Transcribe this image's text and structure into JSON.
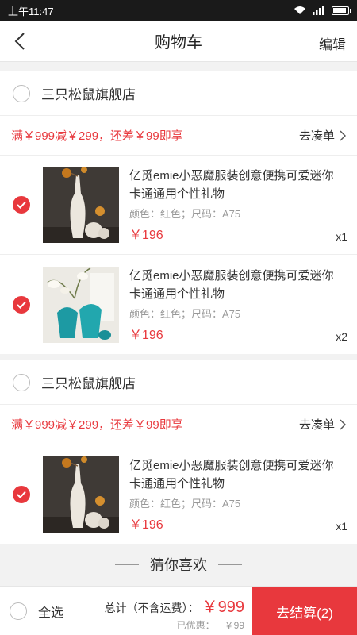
{
  "status": {
    "time": "上午11:47"
  },
  "nav": {
    "title": "购物车",
    "edit": "编辑"
  },
  "stores": [
    {
      "name": "三只松鼠旗舰店",
      "promo": "满￥999减￥299，还差￥99即享",
      "promo_link": "去凑单",
      "items": [
        {
          "title": "亿觅emie小恶魔服装创意便携可爱迷你卡通通用个性礼物",
          "attrs": "颜色：红色；尺码：A75",
          "price": "￥196",
          "qty": "x1"
        },
        {
          "title": "亿觅emie小恶魔服装创意便携可爱迷你卡通通用个性礼物",
          "attrs": "颜色：红色；尺码：A75",
          "price": "￥196",
          "qty": "x2"
        }
      ]
    },
    {
      "name": "三只松鼠旗舰店",
      "promo": "满￥999减￥299，还差￥99即享",
      "promo_link": "去凑单",
      "items": [
        {
          "title": "亿觅emie小恶魔服装创意便携可爱迷你卡通通用个性礼物",
          "attrs": "颜色：红色；尺码：A75",
          "price": "￥196",
          "qty": "x1"
        }
      ]
    }
  ],
  "guess": {
    "title": "猜你喜欢"
  },
  "bottom": {
    "select_all": "全选",
    "total_label": "总计（不含运费）：",
    "total_value": "￥999",
    "discount": "已优惠：－￥99",
    "checkout": "去结算(2)"
  },
  "colors": {
    "accent": "#e8383d",
    "background": "#f2f2f2"
  }
}
